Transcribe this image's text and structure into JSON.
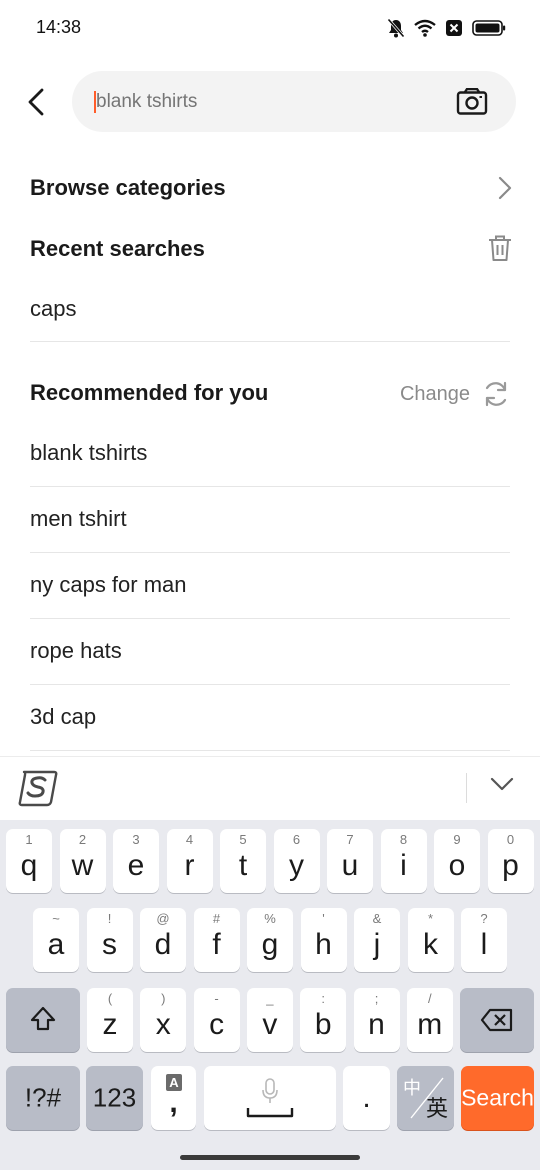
{
  "status_bar": {
    "time": "14:38",
    "icons": [
      "bell-muted-icon",
      "wifi-icon",
      "sim-blocked-icon",
      "battery-icon"
    ]
  },
  "search": {
    "placeholder": "blank tshirts",
    "back_icon": "back-arrow-icon",
    "camera_icon": "camera-icon"
  },
  "browse": {
    "label": "Browse categories"
  },
  "recent": {
    "label": "Recent searches",
    "items": [
      "caps"
    ]
  },
  "recommended": {
    "label": "Recommended for you",
    "change_label": "Change",
    "items": [
      "blank tshirts",
      "men tshirt",
      "ny caps for man",
      "rope hats",
      "3d cap"
    ]
  },
  "keyboard": {
    "row1": [
      {
        "hint": "1",
        "key": "q"
      },
      {
        "hint": "2",
        "key": "w"
      },
      {
        "hint": "3",
        "key": "e"
      },
      {
        "hint": "4",
        "key": "r"
      },
      {
        "hint": "5",
        "key": "t"
      },
      {
        "hint": "6",
        "key": "y"
      },
      {
        "hint": "7",
        "key": "u"
      },
      {
        "hint": "8",
        "key": "i"
      },
      {
        "hint": "9",
        "key": "o"
      },
      {
        "hint": "0",
        "key": "p"
      }
    ],
    "row2": [
      {
        "hint": "~",
        "key": "a"
      },
      {
        "hint": "!",
        "key": "s"
      },
      {
        "hint": "@",
        "key": "d"
      },
      {
        "hint": "#",
        "key": "f"
      },
      {
        "hint": "%",
        "key": "g"
      },
      {
        "hint": "'",
        "key": "h"
      },
      {
        "hint": "&",
        "key": "j"
      },
      {
        "hint": "*",
        "key": "k"
      },
      {
        "hint": "?",
        "key": "l"
      }
    ],
    "row3": [
      {
        "hint": "(",
        "key": "z"
      },
      {
        "hint": ")",
        "key": "x"
      },
      {
        "hint": "-",
        "key": "c"
      },
      {
        "hint": "_",
        "key": "v"
      },
      {
        "hint": ":",
        "key": "b"
      },
      {
        "hint": ";",
        "key": "n"
      },
      {
        "hint": "/",
        "key": "m"
      }
    ],
    "symbols_label": "!?#",
    "numbers_label": "123",
    "comma_hint": "A",
    "comma_label": ",",
    "period_label": ".",
    "lang_top": "中",
    "lang_bottom": "英",
    "search_label": "Search"
  },
  "colors": {
    "accent": "#ff6a2b",
    "caret": "#ff5d2a",
    "keyboard_bg": "#e9eaef"
  }
}
